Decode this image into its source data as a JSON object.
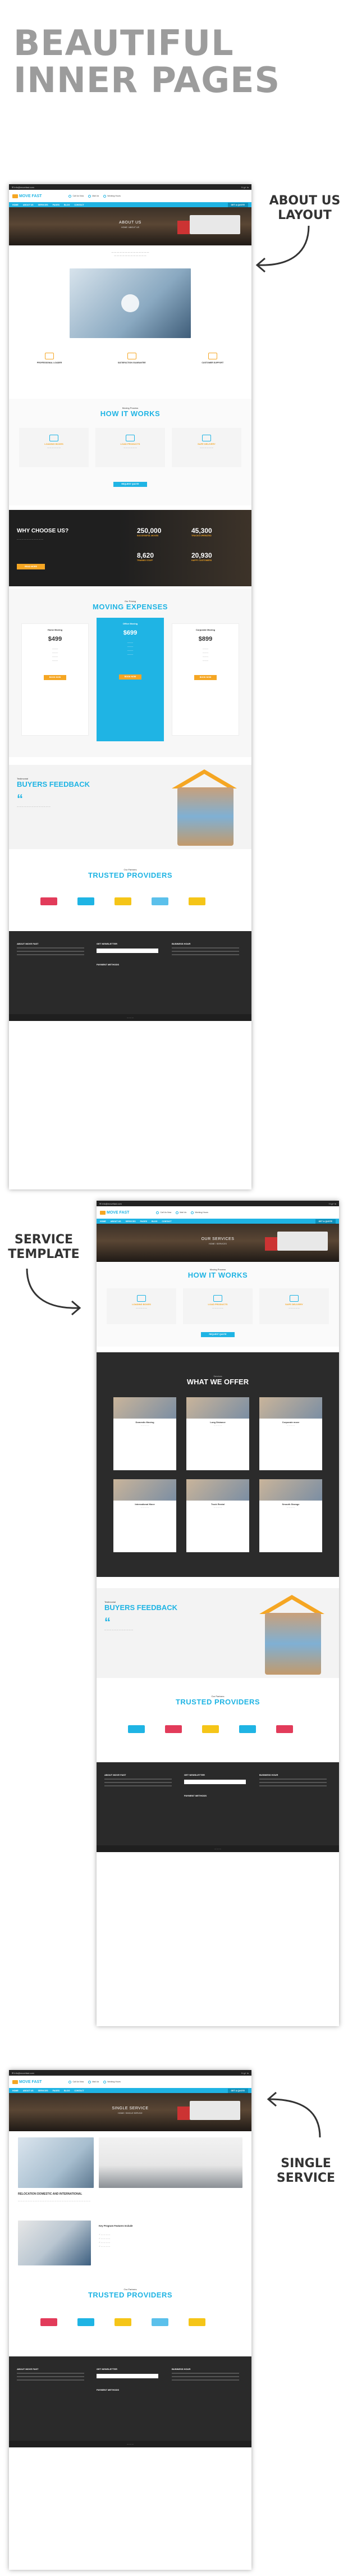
{
  "hero": {
    "line1": "BEAUTIFUL",
    "line2": "INNER PAGES"
  },
  "callouts": {
    "about": {
      "line1": "ABOUT US",
      "line2": "LAYOUT"
    },
    "service": {
      "line1": "SERVICE",
      "line2": "TEMPLATE"
    },
    "single": {
      "line1": "SINGLE",
      "line2": "SERVICE"
    }
  },
  "site": {
    "logo": "MOVE FAST",
    "nav": [
      "HOME",
      "ABOUT US",
      "SERVICES",
      "PAGES",
      "BLOG",
      "CONTACT"
    ],
    "cta": "GET A QUOTE",
    "info": [
      "Call Us Now",
      "Mail Us",
      "Working Hours"
    ]
  },
  "about_page": {
    "banner_title": "ABOUT US",
    "breadcrumb": "HOME / ABOUT US",
    "features": [
      "PROFESSIONAL LOADER",
      "SATISFACTION GUARANTEE",
      "CUSTOMER SUPPORT"
    ],
    "how_kicker": "Moving Process",
    "how_title": "HOW IT WORKS",
    "how_steps": [
      "LOADING BOXES",
      "LOAD PRODUCTS",
      "SAFE DELIVERY"
    ],
    "how_button": "REQUEST QUOTE",
    "why_title": "WHY CHOOSE US?",
    "why_button": "READ MORE",
    "stats": [
      {
        "value": "250,000",
        "label": "SUCCESSFUL MOVES"
      },
      {
        "value": "45,300",
        "label": "TRUCKS OPERATED"
      },
      {
        "value": "8,620",
        "label": "TRAINED STAFF"
      },
      {
        "value": "20,930",
        "label": "HAPPY CUSTOMERS"
      }
    ],
    "pricing_kicker": "Our Pricing",
    "pricing_title": "MOVING EXPENSES",
    "plans": [
      {
        "name": "Home Moving",
        "price": "$499"
      },
      {
        "name": "Office Moving",
        "price": "$699"
      },
      {
        "name": "Corporate Moving",
        "price": "$899"
      }
    ],
    "plan_button": "BOOK NOW",
    "fb_kicker": "Testimonial",
    "fb_title": "BUYERS FEEDBACK",
    "partners_kicker": "Our Partners",
    "partners_title": "TRUSTED PROVIDERS",
    "footer_cols": [
      "ABOUT MOVE FAST",
      "GET NEWSLETTER",
      "BUSINESS HOUR"
    ],
    "payment_label": "PAYMENT METHODS"
  },
  "service_page": {
    "banner_title": "OUR SERVICES",
    "breadcrumb": "HOME / SERVICES",
    "how_kicker": "Moving Process",
    "how_title": "HOW IT WORKS",
    "how_steps": [
      "LOADING BOXES",
      "LOAD PRODUCTS",
      "SAFE DELIVERY"
    ],
    "how_button": "REQUEST QUOTE",
    "offer_kicker": "Services",
    "offer_title": "WHAT WE OFFER",
    "offers": [
      "Domestic Moving",
      "Long Distance",
      "Corporate move",
      "International Move",
      "Truck Rental",
      "Smooth Storage"
    ],
    "fb_kicker": "Testimonial",
    "fb_title": "BUYERS FEEDBACK",
    "partners_kicker": "Our Partners",
    "partners_title": "TRUSTED PROVIDERS",
    "footer_cols": [
      "ABOUT MOVE FAST",
      "GET NEWSLETTER",
      "BUSINESS HOUR"
    ],
    "payment_label": "PAYMENT METHODS"
  },
  "single_page": {
    "banner_title": "SINGLE SERVICE",
    "breadcrumb": "HOME / SINGLE SERVICE",
    "section_title": "RELOCATION DOMESTIC AND INTERNATIONAL",
    "program_title": "Key Program Features Include",
    "partners_kicker": "Our Partners",
    "partners_title": "TRUSTED PROVIDERS",
    "footer_cols": [
      "ABOUT MOVE FAST",
      "GET NEWSLETTER",
      "BUSINESS HOUR"
    ],
    "payment_label": "PAYMENT METHODS"
  },
  "colors": {
    "accent": "#1fb4e4",
    "orange": "#f5a623",
    "dark": "#2b2b2b"
  }
}
